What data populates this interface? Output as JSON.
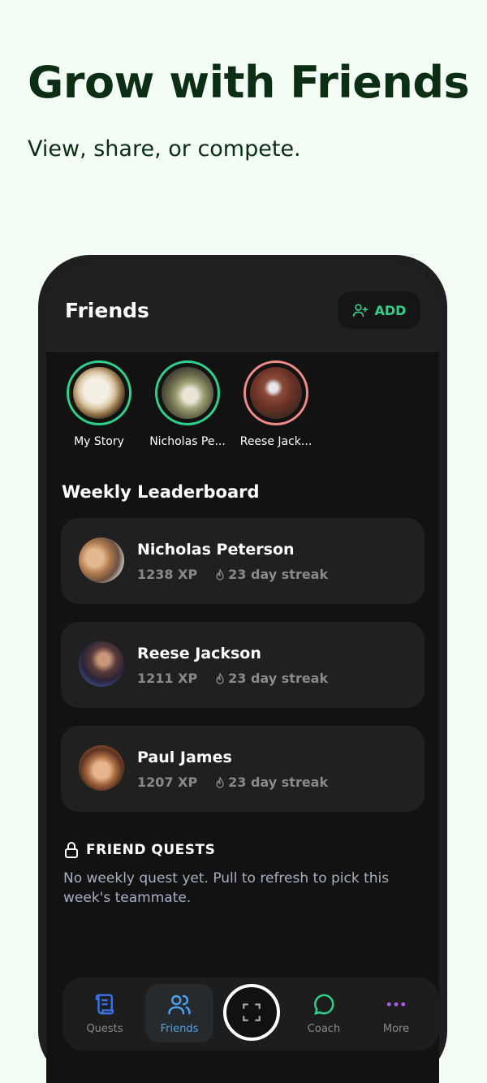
{
  "hero": {
    "title": "Grow with Friends",
    "subtitle": "View, share, or compete."
  },
  "header": {
    "title": "Friends",
    "add_label": "ADD",
    "add_icon": "user-plus-icon"
  },
  "stories": [
    {
      "label": "My Story",
      "ring_color": "#2fd08a"
    },
    {
      "label": "Nicholas Pe...",
      "ring_color": "#2fd08a"
    },
    {
      "label": "Reese Jack...",
      "ring_color": "#f08a86"
    }
  ],
  "leaderboard": {
    "title": "Weekly Leaderboard",
    "entries": [
      {
        "name": "Nicholas Peterson",
        "xp": "1238 XP",
        "streak": "23 day streak"
      },
      {
        "name": "Reese Jackson",
        "xp": "1211 XP",
        "streak": "23 day streak"
      },
      {
        "name": "Paul James",
        "xp": "1207 XP",
        "streak": "23 day streak"
      }
    ]
  },
  "friend_quests": {
    "title": "FRIEND QUESTS",
    "icon": "lock-icon",
    "message": "No weekly quest yet. Pull to refresh to pick this week's teammate."
  },
  "nav": {
    "items": [
      {
        "label": "Quests",
        "icon": "scroll-icon",
        "color": "#3b6fe0"
      },
      {
        "label": "Friends",
        "icon": "users-icon",
        "color": "#4aa3f0",
        "active": true
      },
      {
        "label": "Coach",
        "icon": "chat-icon",
        "color": "#2fd08a"
      },
      {
        "label": "More",
        "icon": "more-dots-icon",
        "color": "#a45be0"
      }
    ],
    "scan_icon": "scan-frame-icon"
  },
  "colors": {
    "accent": "#2fd08a",
    "background": "#f3fdf5",
    "hero_text": "#0b2e14"
  }
}
